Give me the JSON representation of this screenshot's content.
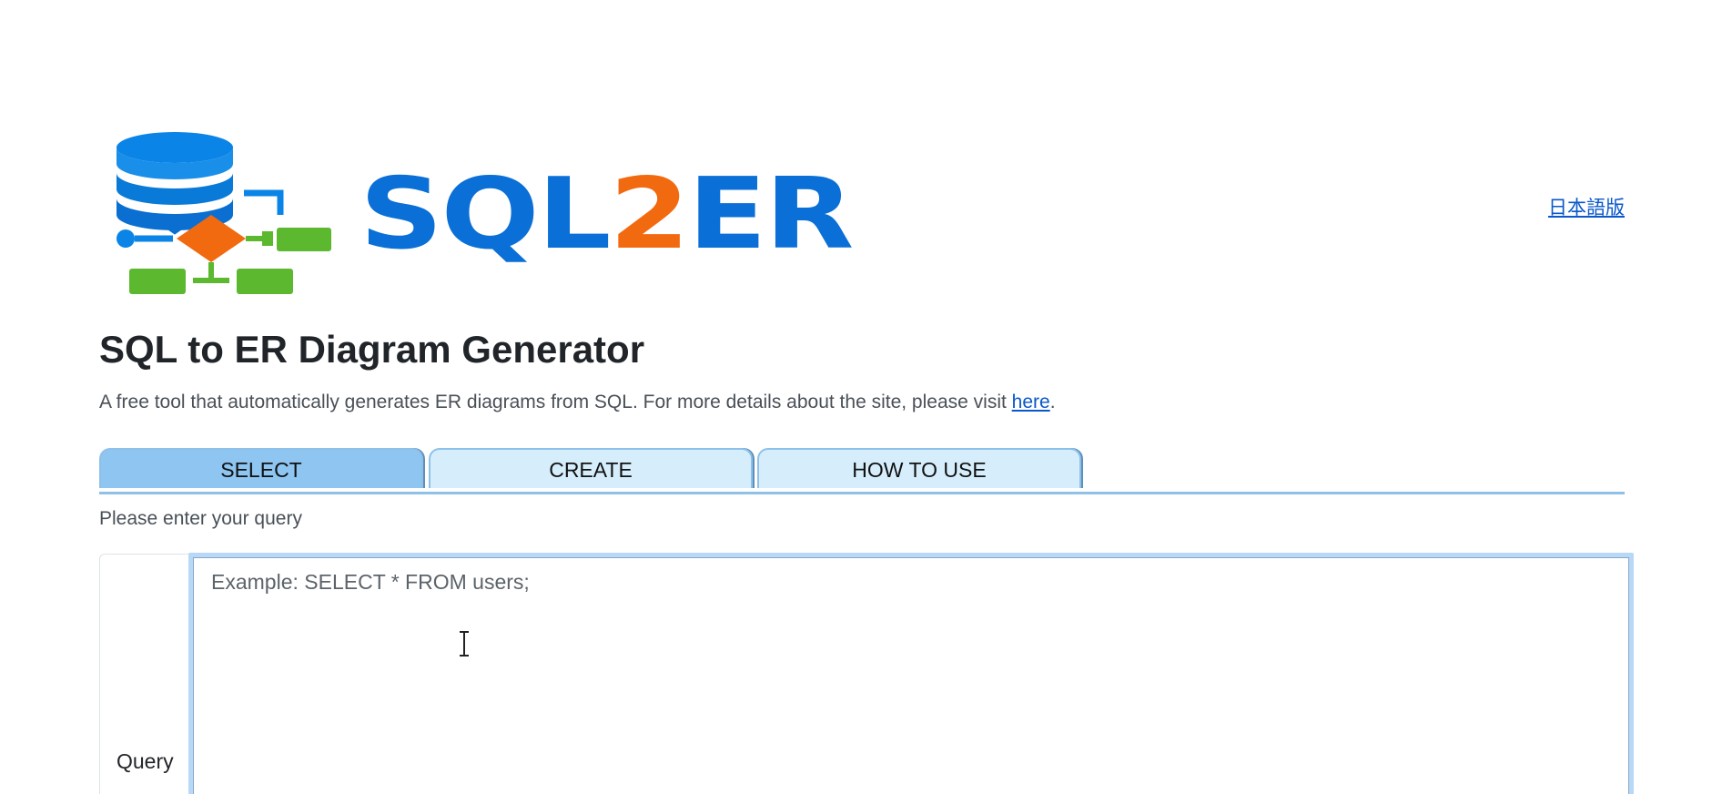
{
  "header": {
    "logo_text_part1": "SQL",
    "logo_text_part2": "2",
    "logo_text_part3": "ER",
    "language_link": "日本語版",
    "colors": {
      "brand_blue": "#0a6fd6",
      "brand_orange": "#f26a10",
      "brand_green": "#5cb82e"
    }
  },
  "main": {
    "title": "SQL to ER Diagram Generator",
    "description_prefix": "A free tool that automatically generates ER diagrams from SQL. For more details about the site, please visit ",
    "description_link": "here",
    "description_suffix": ".",
    "tabs": [
      {
        "label": "SELECT",
        "active": true
      },
      {
        "label": "CREATE",
        "active": false
      },
      {
        "label": "HOW TO USE",
        "active": false
      }
    ],
    "prompt": "Please enter your query",
    "query_label": "Query",
    "query_placeholder": "Example: SELECT * FROM users;",
    "query_value": ""
  }
}
